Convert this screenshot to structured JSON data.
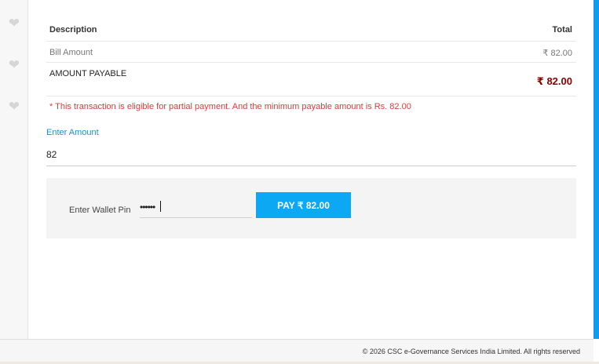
{
  "sidebar": {
    "icons": [
      "heart-icon",
      "heart-icon",
      "heart-icon"
    ]
  },
  "summary": {
    "header": {
      "description": "Description",
      "total": "Total"
    },
    "rows": [
      {
        "label": "Bill Amount",
        "value": "₹ 82.00"
      }
    ],
    "payable": {
      "label": "AMOUNT PAYABLE",
      "value": "₹ 82.00"
    }
  },
  "notice": "* This transaction is eligible for partial payment. And the minimum payable amount is Rs. 82.00",
  "amount": {
    "label": "Enter Amount",
    "value": "82"
  },
  "wallet": {
    "pin_label": "Enter Wallet Pin",
    "pin_value": "••••••",
    "pay_button": "PAY ₹ 82.00"
  },
  "footer": {
    "text": "© 2026 CSC e-Governance Services India Limited. All rights reserved"
  },
  "colors": {
    "accent": "#0e9cf0",
    "button": "#0da8f4",
    "payable": "#8b0000",
    "notice": "#e03a3a",
    "link": "#1a8fd6"
  }
}
